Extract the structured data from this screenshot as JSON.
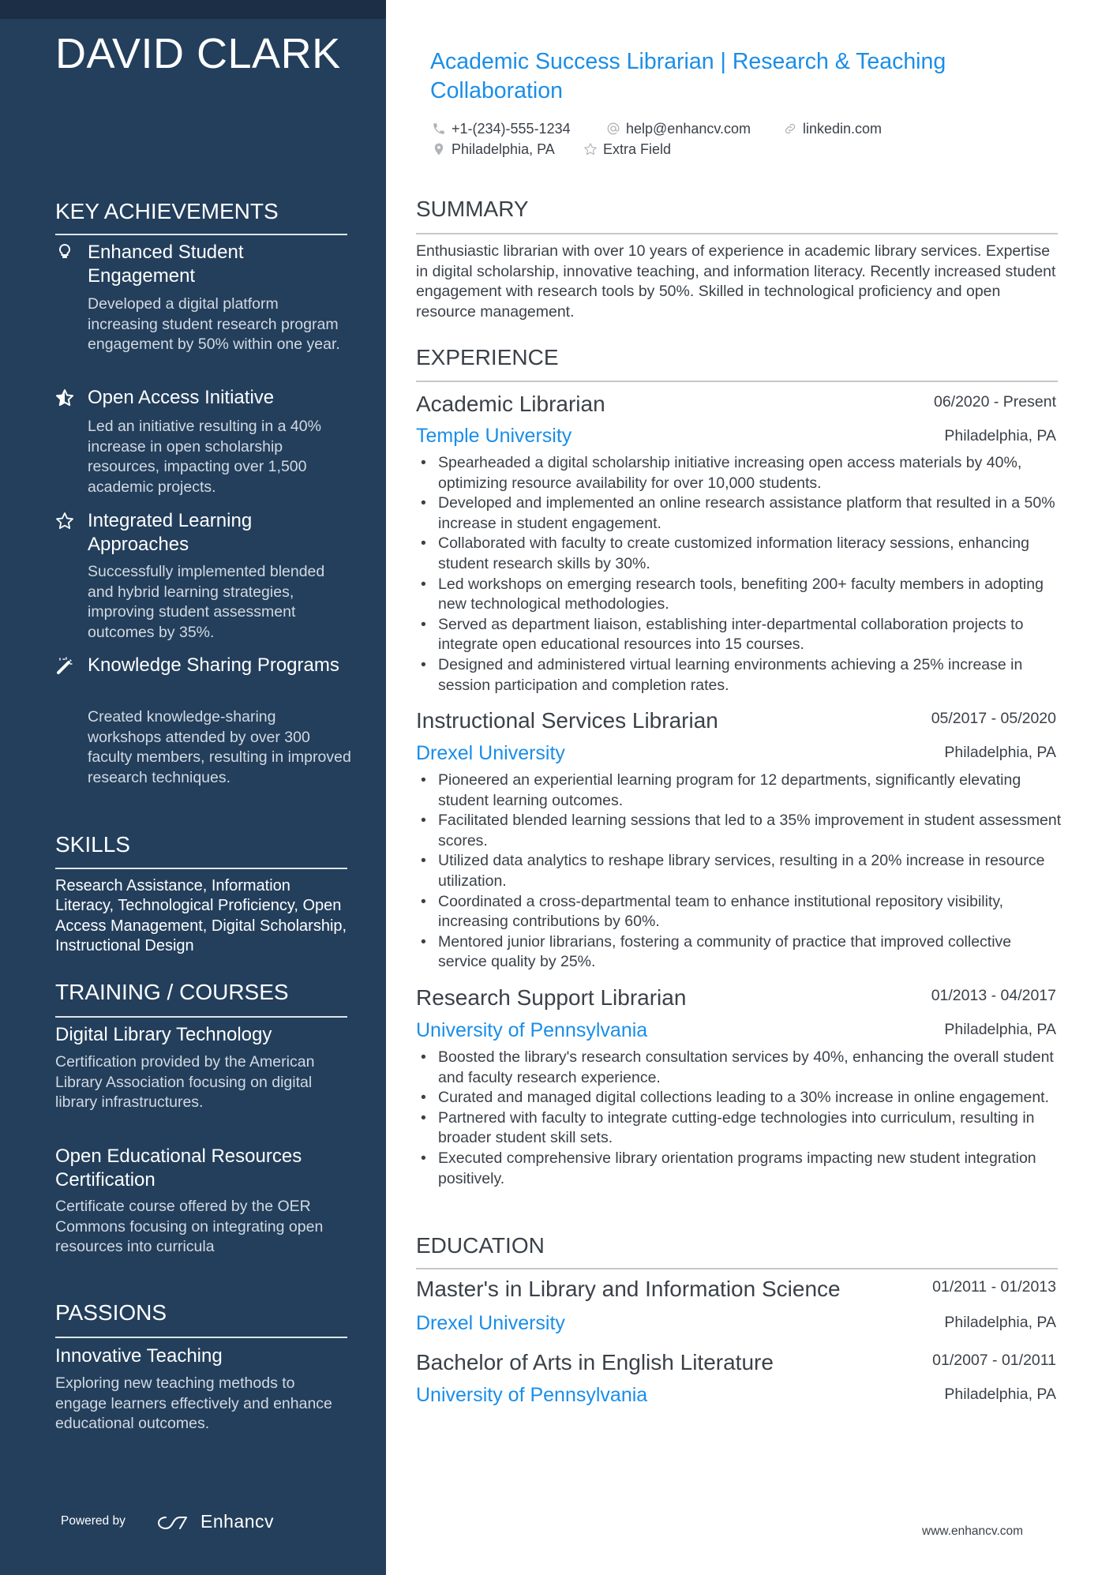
{
  "colors": {
    "sidebar_bg": "#233f5c",
    "topbar_bg": "#1b2e45",
    "accent": "#1a8ee8",
    "text": "#3b4148"
  },
  "sidebar": {
    "name": "DAVID CLARK",
    "key_achievements": {
      "heading": "KEY ACHIEVEMENTS",
      "items": [
        {
          "icon": "lightbulb-icon",
          "title": "Enhanced Student Engagement",
          "description": "Developed a digital platform increasing student research program engagement by 50% within one year."
        },
        {
          "icon": "star-half-icon",
          "title": "Open Access Initiative",
          "description": "Led an initiative resulting in a 40% increase in open scholarship resources, impacting over 1,500 academic projects."
        },
        {
          "icon": "star-outline-icon",
          "title": "Integrated Learning Approaches",
          "description": "Successfully implemented blended and hybrid learning strategies, improving student assessment outcomes by 35%."
        },
        {
          "icon": "magic-wand-icon",
          "title": "Knowledge Sharing Programs",
          "description": "Created knowledge-sharing workshops attended by over 300 faculty members, resulting in improved research techniques."
        }
      ]
    },
    "skills": {
      "heading": "SKILLS",
      "text": "Research Assistance, Information Literacy, Technological Proficiency, Open Access Management, Digital Scholarship, Instructional Design"
    },
    "training": {
      "heading": "TRAINING / COURSES",
      "items": [
        {
          "title": "Digital Library Technology",
          "description": "Certification provided by the American Library Association focusing on digital library infrastructures."
        },
        {
          "title": "Open Educational Resources Certification",
          "description": "Certificate course offered by the OER Commons focusing on integrating open resources into curricula"
        }
      ]
    },
    "passions": {
      "heading": "PASSIONS",
      "items": [
        {
          "title": "Innovative Teaching",
          "description": "Exploring new teaching methods to engage learners effectively and enhance educational outcomes."
        }
      ]
    },
    "footer": {
      "powered_by": "Powered by",
      "brand": "Enhancv"
    }
  },
  "header": {
    "title": "Academic Success Librarian | Research & Teaching Collaboration",
    "contacts": [
      {
        "icon": "phone-icon",
        "text": "+1-(234)-555-1234"
      },
      {
        "icon": "at-icon",
        "text": "help@enhancv.com"
      },
      {
        "icon": "link-icon",
        "text": "linkedin.com"
      },
      {
        "icon": "location-pin-icon",
        "text": "Philadelphia, PA"
      },
      {
        "icon": "star-icon",
        "text": "Extra Field"
      }
    ]
  },
  "summary": {
    "heading": "SUMMARY",
    "text": "Enthusiastic librarian with over 10 years of experience in academic library services. Expertise in digital scholarship, innovative teaching, and information literacy. Recently increased student engagement with research tools by 50%. Skilled in technological proficiency and open resource management."
  },
  "experience": {
    "heading": "EXPERIENCE",
    "jobs": [
      {
        "title": "Academic Librarian",
        "dates": "06/2020 - Present",
        "org": "Temple University",
        "location": "Philadelphia, PA",
        "bullets": [
          "Spearheaded a digital scholarship initiative increasing open access materials by 40%, optimizing resource availability for over 10,000 students.",
          "Developed and implemented an online research assistance platform that resulted in a 50% increase in student engagement.",
          "Collaborated with faculty to create customized information literacy sessions, enhancing student research skills by 30%.",
          "Led workshops on emerging research tools, benefiting 200+ faculty members in adopting new technological methodologies.",
          "Served as department liaison, establishing inter-departmental collaboration projects to integrate open educational resources into 15 courses.",
          "Designed and administered virtual learning environments achieving a 25% increase in session participation and completion rates."
        ]
      },
      {
        "title": "Instructional Services Librarian",
        "dates": "05/2017 - 05/2020",
        "org": "Drexel University",
        "location": "Philadelphia, PA",
        "bullets": [
          "Pioneered an experiential learning program for 12 departments, significantly elevating student learning outcomes.",
          "Facilitated blended learning sessions that led to a 35% improvement in student assessment scores.",
          "Utilized data analytics to reshape library services, resulting in a 20% increase in resource utilization.",
          "Coordinated a cross-departmental team to enhance institutional repository visibility, increasing contributions by 60%.",
          "Mentored junior librarians, fostering a community of practice that improved collective service quality by 25%."
        ]
      },
      {
        "title": "Research Support Librarian",
        "dates": "01/2013 - 04/2017",
        "org": "University of Pennsylvania",
        "location": "Philadelphia, PA",
        "bullets": [
          "Boosted the library's research consultation services by 40%, enhancing the overall student and faculty research experience.",
          "Curated and managed digital collections leading to a 30% increase in online engagement.",
          "Partnered with faculty to integrate cutting-edge technologies into curriculum, resulting in broader student skill sets.",
          "Executed comprehensive library orientation programs impacting new student integration positively."
        ]
      }
    ]
  },
  "education": {
    "heading": "EDUCATION",
    "items": [
      {
        "degree": "Master's in Library and Information Science",
        "dates": "01/2011 - 01/2013",
        "school": "Drexel University",
        "location": "Philadelphia, PA"
      },
      {
        "degree": "Bachelor of Arts in English Literature",
        "dates": "01/2007 - 01/2011",
        "school": "University of Pennsylvania",
        "location": "Philadelphia, PA"
      }
    ]
  },
  "footer": {
    "url": "www.enhancv.com"
  }
}
